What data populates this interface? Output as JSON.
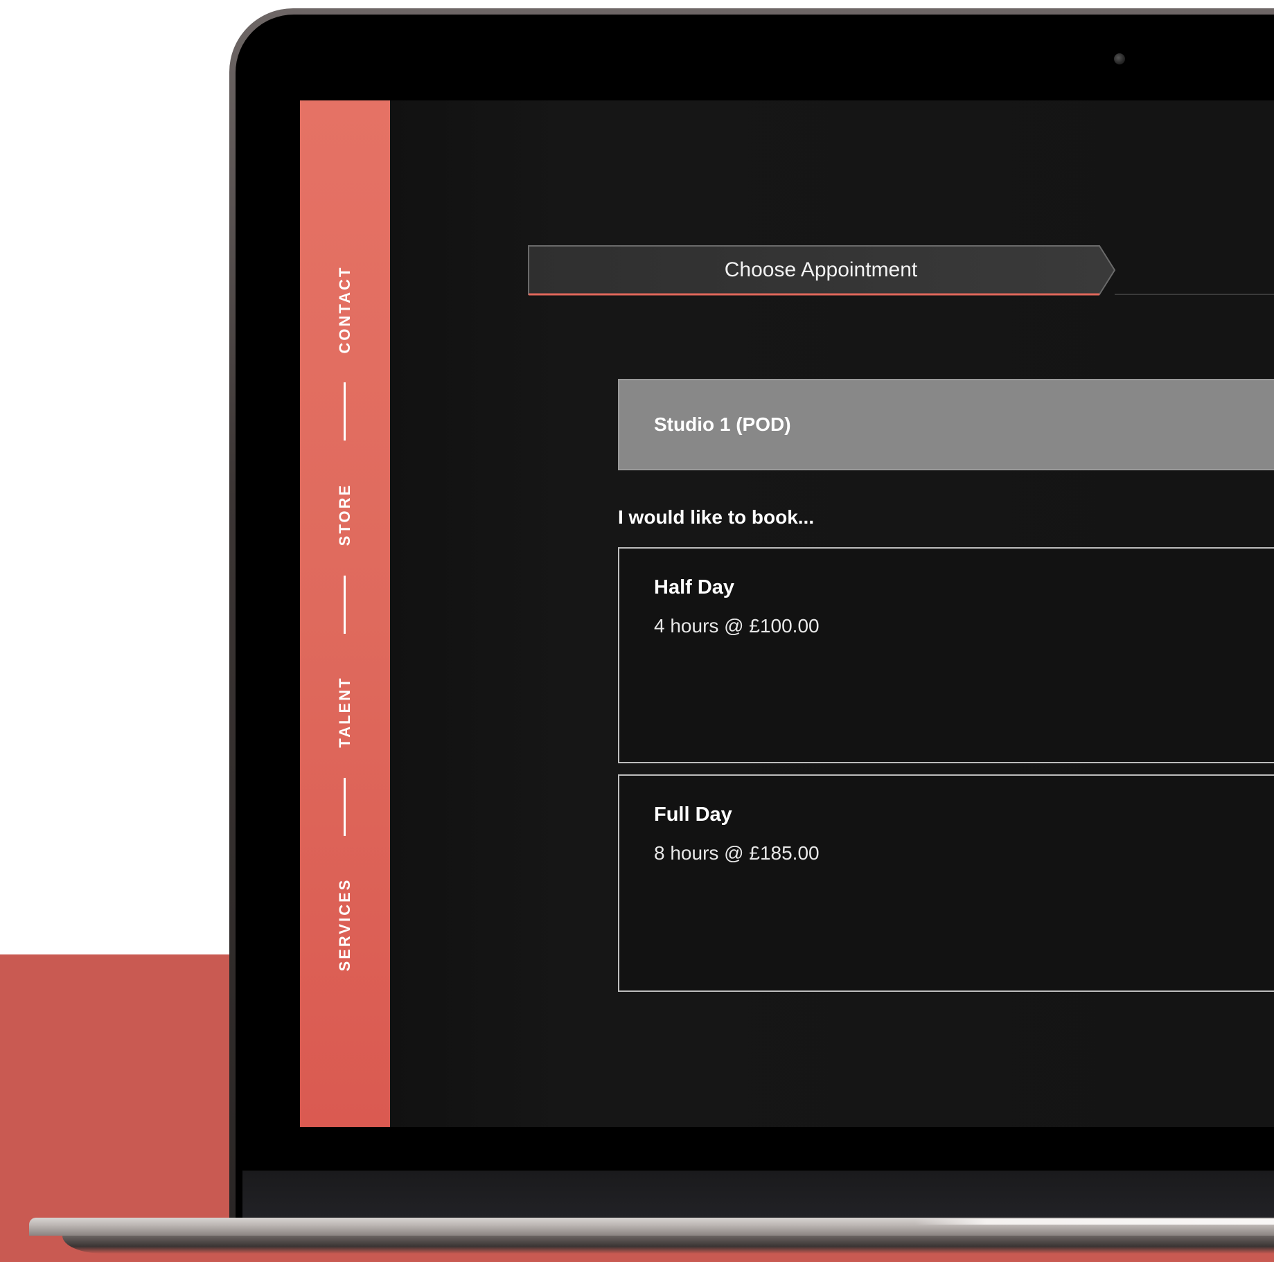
{
  "sidebar": {
    "items": [
      {
        "label": "CONTACT"
      },
      {
        "label": "STORE"
      },
      {
        "label": "TALENT"
      },
      {
        "label": "SERVICES"
      }
    ]
  },
  "progress": {
    "current_step_label": "Choose Appointment"
  },
  "booking": {
    "studio_label": "Studio 1 (POD)",
    "prompt": "I would like to book...",
    "options": [
      {
        "title": "Half Day",
        "detail": "4 hours @ £100.00"
      },
      {
        "title": "Full Day",
        "detail": "8 hours @ £185.00"
      }
    ]
  },
  "colors": {
    "accent": "#e0675b",
    "background": "#141414",
    "studio_bar": "#888888"
  }
}
